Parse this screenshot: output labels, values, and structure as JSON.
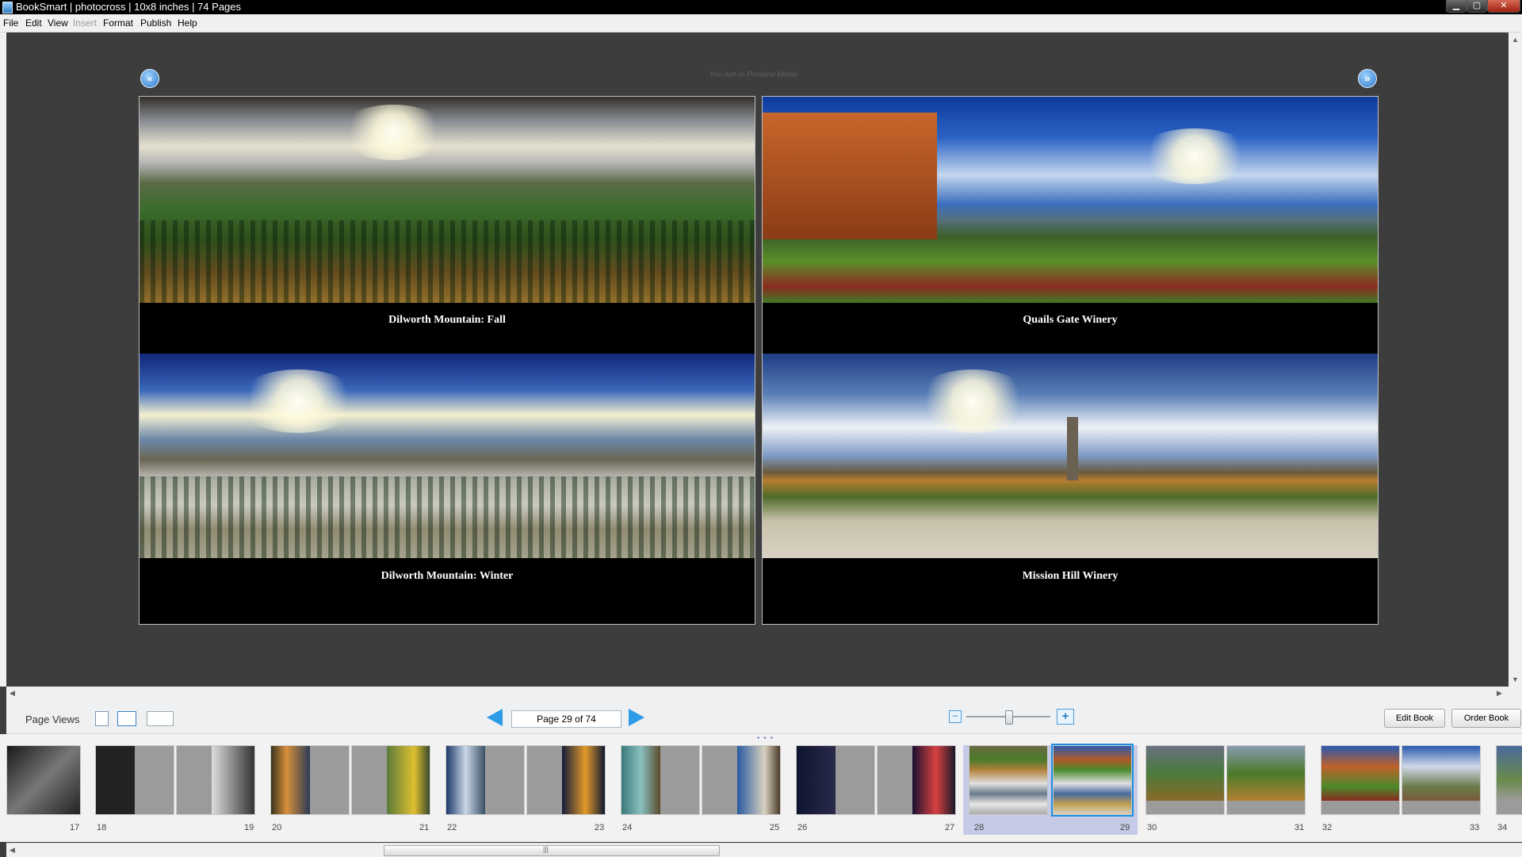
{
  "window": {
    "title": "BookSmart  |  photocross  |  10x8 inches  |  74 Pages",
    "controls": {
      "minimize": "▁",
      "maximize": "▢",
      "close": "✕"
    }
  },
  "menu": {
    "items": [
      {
        "label": "File",
        "enabled": true
      },
      {
        "label": "Edit",
        "enabled": true
      },
      {
        "label": "View",
        "enabled": true
      },
      {
        "label": "Insert",
        "enabled": false
      },
      {
        "label": "Format",
        "enabled": true
      },
      {
        "label": "Publish",
        "enabled": true
      },
      {
        "label": "Help",
        "enabled": true
      }
    ]
  },
  "preview": {
    "mode_note": "You Are in Preview Mode",
    "left_nav_glyph": "«",
    "right_nav_glyph": "»",
    "left_page": {
      "captions": [
        "Dilworth Mountain: Fall",
        "Dilworth Mountain: Winter"
      ]
    },
    "right_page": {
      "captions": [
        "Quails Gate Winery",
        "Mission Hill Winery"
      ]
    }
  },
  "toolbar": {
    "page_views_label": "Page Views",
    "page_indicator": "Page 29 of 74",
    "zoom_out_glyph": "−",
    "zoom_in_glyph": "+",
    "zoom_level": 0.5,
    "edit_book": "Edit Book",
    "order_book": "Order Book"
  },
  "thumbnails": {
    "handle_glyph": "• • •",
    "page_numbers": [
      "17",
      "18",
      "19",
      "20",
      "21",
      "22",
      "23",
      "24",
      "25",
      "26",
      "27",
      "28",
      "29",
      "30",
      "31",
      "32",
      "33",
      "34"
    ],
    "selected_spread": "28-29"
  },
  "scrollbars": {
    "left_arrow": "◀",
    "right_arrow": "▶",
    "up_arrow": "▲",
    "down_arrow": "▼",
    "grip": "|||"
  },
  "colors": {
    "accent": "#2d9be6",
    "workspace": "#3d3d3d",
    "selected_spread": "#c5cbe6"
  }
}
